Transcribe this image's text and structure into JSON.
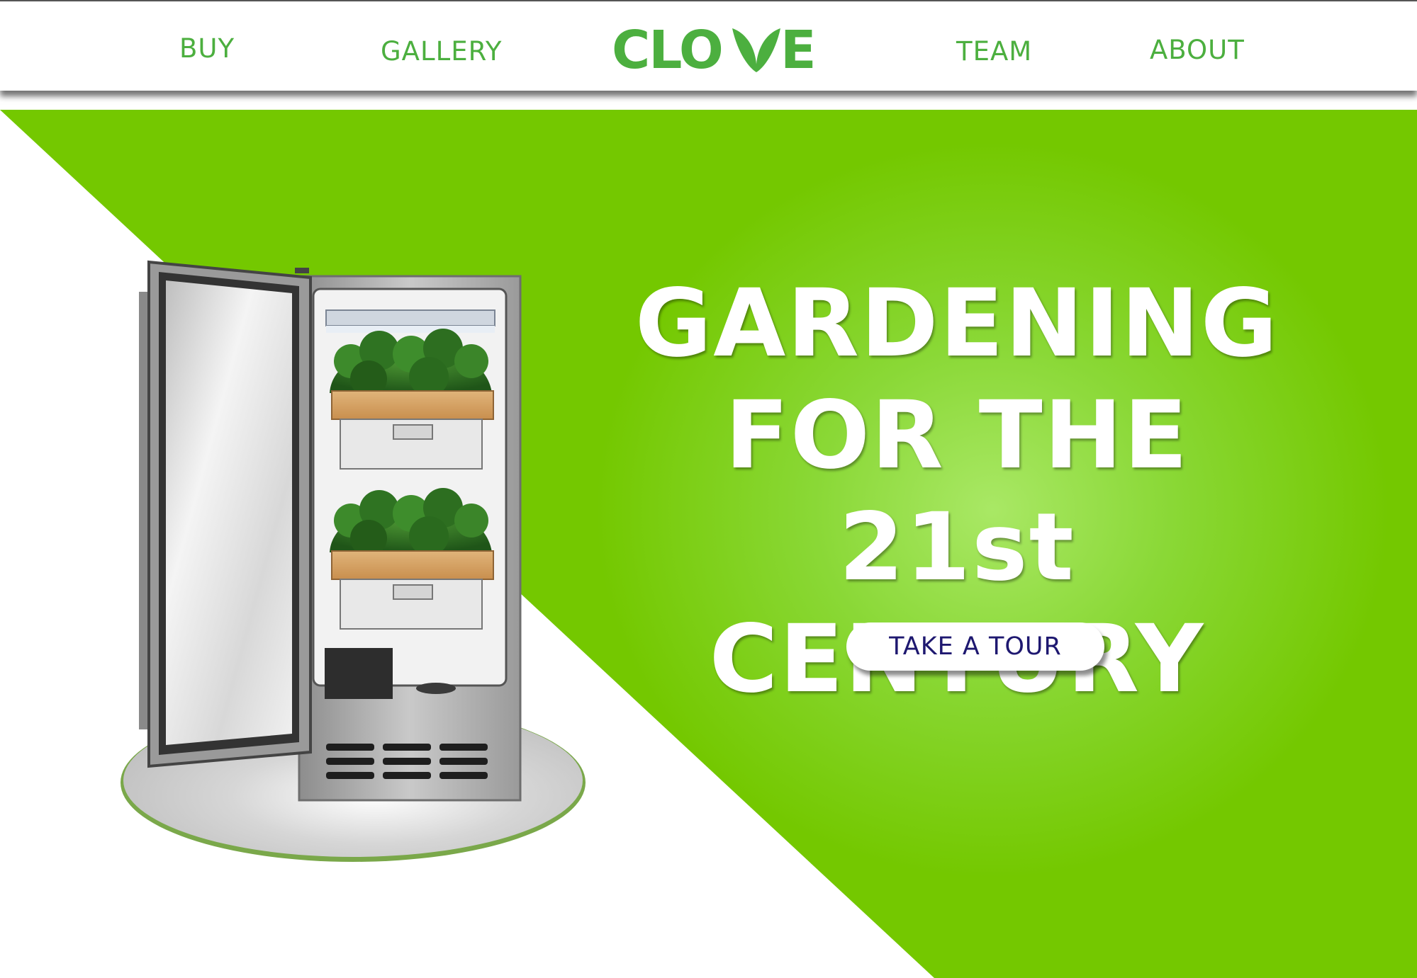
{
  "nav": {
    "buy": "BUY",
    "gallery": "GALLERY",
    "team": "TEAM",
    "about": "ABOUT"
  },
  "brand": {
    "logo_text": "CLOVE",
    "color": "#4caf3f"
  },
  "hero": {
    "headline_line1": "GARDENING",
    "headline_line2": "FOR THE 21st",
    "headline_line3": "CENTURY",
    "cta_label": "TAKE A TOUR",
    "cta_text_color": "#1e1870",
    "green": "#74c800",
    "green_light": "#a9e865"
  }
}
